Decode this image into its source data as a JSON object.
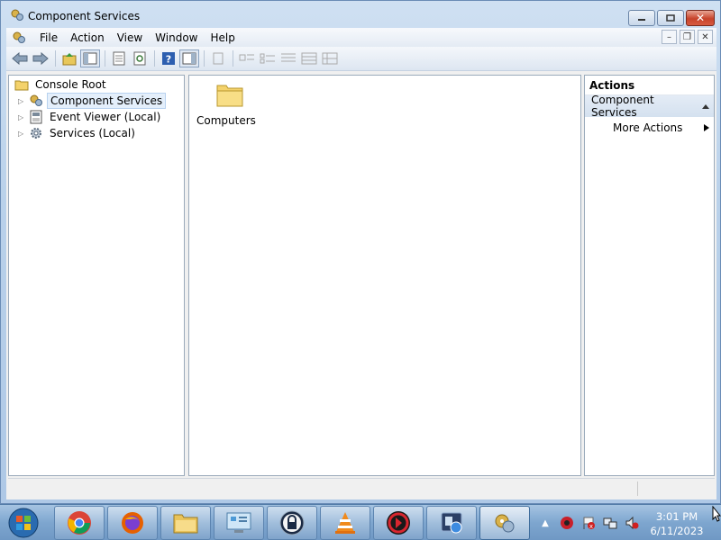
{
  "window": {
    "title": "Component Services",
    "buttons": [
      "minimize-icon",
      "maximize-icon",
      "close-icon"
    ]
  },
  "menubar": {
    "items": [
      "File",
      "Action",
      "View",
      "Window",
      "Help"
    ]
  },
  "toolbar": {
    "icons": [
      "back-arrow-icon",
      "forward-arrow-icon",
      "up-folder-icon",
      "show-hide-tree-icon",
      "properties-icon",
      "refresh-icon",
      "help-icon",
      "show-hide-action-pane-icon",
      "disabled-icon",
      "large-icons-icon",
      "small-icons-icon",
      "list-icon",
      "details-icon"
    ]
  },
  "tree": {
    "root": "Console Root",
    "items": [
      {
        "label": "Component Services",
        "icon": "component-services-icon",
        "selected": true
      },
      {
        "label": "Event Viewer (Local)",
        "icon": "event-viewer-icon",
        "selected": false
      },
      {
        "label": "Services (Local)",
        "icon": "services-gear-icon",
        "selected": false
      }
    ]
  },
  "main": {
    "items": [
      {
        "label": "Computers",
        "icon": "folder-icon"
      }
    ]
  },
  "actions": {
    "header": "Actions",
    "section": "Component Services",
    "items": [
      "More Actions"
    ]
  },
  "taskbar": {
    "apps": [
      "chrome-icon",
      "firefox-icon",
      "file-explorer-icon",
      "control-panel-icon",
      "keepass-icon",
      "vlc-icon",
      "red-app-icon",
      "remote-app-icon",
      "component-services-icon"
    ],
    "tray": [
      "show-hidden-icons-arrow",
      "security-icon",
      "flag-icon",
      "network-icon",
      "volume-muted-icon"
    ],
    "clock": {
      "time": "3:01 PM",
      "date": "6/11/2023"
    }
  },
  "colors": {
    "accent": "#3f6d9c",
    "selection": "#e4effb",
    "folder": "#f4d26b"
  }
}
